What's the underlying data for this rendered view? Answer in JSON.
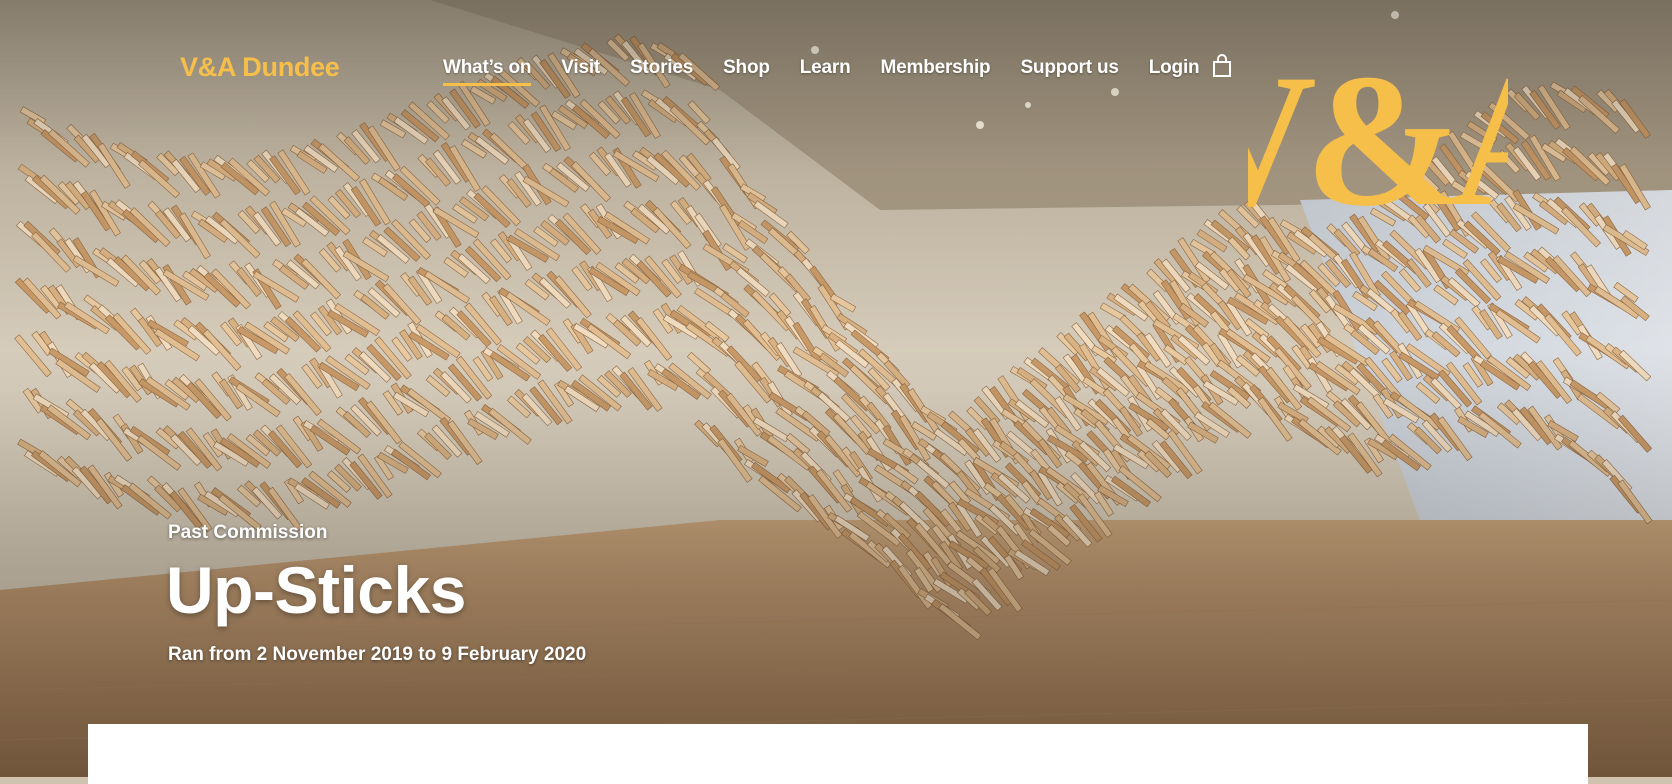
{
  "header": {
    "site_name": "V&A Dundee",
    "logo_text": "V&A",
    "nav": [
      {
        "label": "What’s on",
        "active": true
      },
      {
        "label": "Visit"
      },
      {
        "label": "Stories"
      },
      {
        "label": "Shop"
      },
      {
        "label": "Learn"
      },
      {
        "label": "Membership"
      },
      {
        "label": "Support us"
      },
      {
        "label": "Login"
      }
    ],
    "cart_icon": "shopping-bag-icon"
  },
  "hero": {
    "eyebrow": "Past Commission",
    "title": "Up-Sticks",
    "dates": "Ran from 2 November 2019 to 9 February 2020"
  },
  "colors": {
    "accent": "#f5bf49",
    "text": "#ffffff",
    "panel": "#ffffff"
  }
}
